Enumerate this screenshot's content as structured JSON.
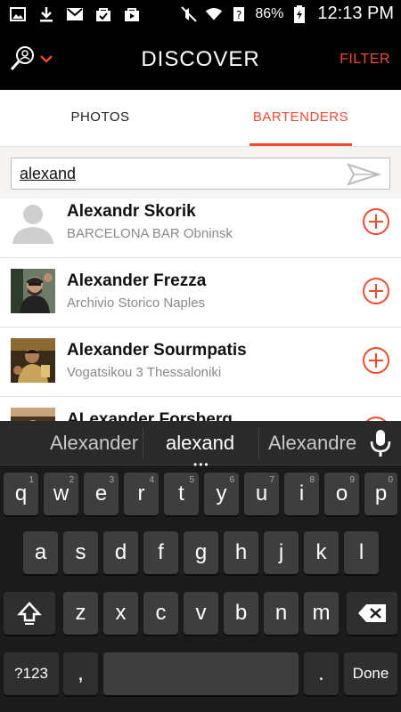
{
  "status_bar": {
    "battery_pct": "86%",
    "time": "12:13 PM"
  },
  "header": {
    "title": "DISCOVER",
    "filter_label": "FILTER"
  },
  "tabs": [
    {
      "label": "PHOTOS",
      "active": false
    },
    {
      "label": "BARTENDERS",
      "active": true
    }
  ],
  "search": {
    "value": "alexand"
  },
  "results": [
    {
      "name": "Alexandr Skorik",
      "place": "BARCELONA BAR Obninsk"
    },
    {
      "name": "Alexander Frezza",
      "place": "Archivio Storico Naples"
    },
    {
      "name": "Alexander Sourmpatis",
      "place": "Vogatsikou 3 Thessaloniki"
    },
    {
      "name": "ALexander Forsberg",
      "place": ""
    }
  ],
  "keyboard": {
    "suggestions": [
      "Alexander",
      "alexand",
      "Alexandre"
    ],
    "row1": [
      "q",
      "w",
      "e",
      "r",
      "t",
      "y",
      "u",
      "i",
      "o",
      "p"
    ],
    "row1_hints": [
      "1",
      "2",
      "3",
      "4",
      "5",
      "6",
      "7",
      "8",
      "9",
      "0"
    ],
    "row2": [
      "a",
      "s",
      "d",
      "f",
      "g",
      "h",
      "j",
      "k",
      "l"
    ],
    "row3": [
      "z",
      "x",
      "c",
      "v",
      "b",
      "n",
      "m"
    ],
    "sym_label": "?123",
    "comma": ",",
    "period": ".",
    "done_label": "Done"
  },
  "colors": {
    "accent": "#f04a2f",
    "header_bg": "#000000",
    "keyboard_bg": "#1b1b1b",
    "key_bg": "#3e3e3e"
  }
}
